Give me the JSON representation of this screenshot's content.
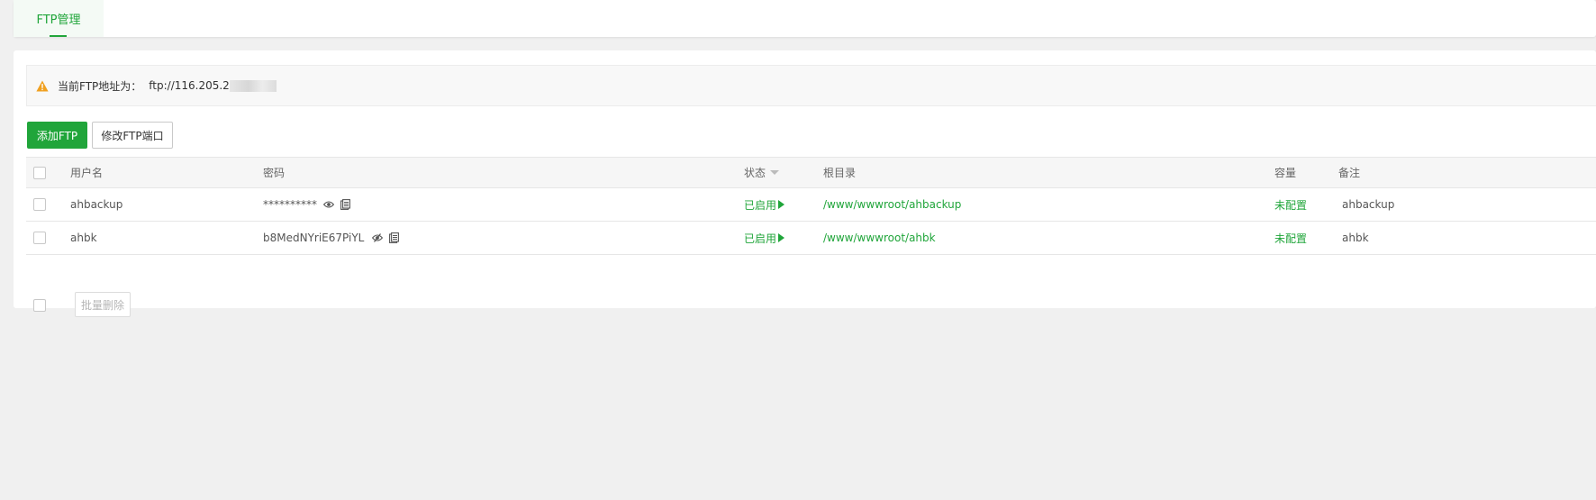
{
  "tabs": [
    {
      "label": "FTP管理",
      "active": true
    }
  ],
  "notice": {
    "label": "当前FTP地址为：",
    "address": "ftp://116.205.2",
    "icon": "warning-icon",
    "icon_color": "#f0a020"
  },
  "toolbar": {
    "add_label": "添加FTP",
    "port_label": "修改FTP端口"
  },
  "table": {
    "columns": {
      "username": "用户名",
      "password": "密码",
      "status": "状态",
      "root": "根目录",
      "capacity": "容量",
      "note": "备注"
    },
    "rows": [
      {
        "username": "ahbackup",
        "password": "**********",
        "password_icon": "eye-icon",
        "status": "已启用",
        "root": "/www/wwwroot/ahbackup",
        "capacity": "未配置",
        "note": "ahbackup"
      },
      {
        "username": "ahbk",
        "password": "b8MedNYriE67PiYL",
        "password_icon": "eye-slash-icon",
        "status": "已启用",
        "root": "/www/wwwroot/ahbk",
        "capacity": "未配置",
        "note": "ahbk"
      }
    ]
  },
  "footer": {
    "batch_delete_label": "批量删除"
  },
  "colors": {
    "accent": "#20a53a",
    "background": "#f0f0f0"
  }
}
